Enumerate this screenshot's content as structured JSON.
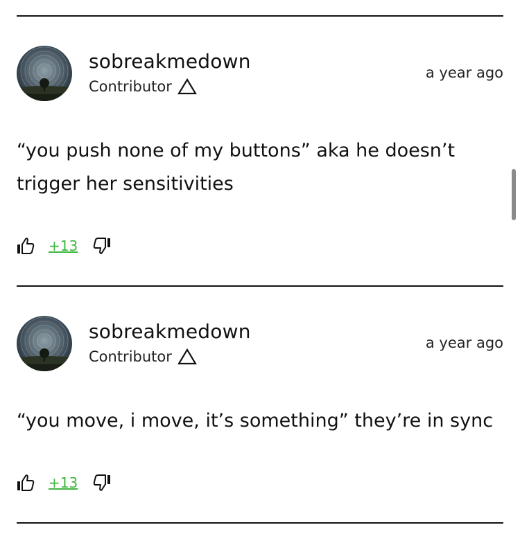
{
  "comments": [
    {
      "username": "sobreakmedown",
      "role": "Contributor",
      "timestamp": "a year ago",
      "text": "“you push none of my buttons” aka he doesn’t trigger her sensitivities",
      "score": "+13",
      "icons": {
        "role": "triangle-icon",
        "upvote": "thumbs-up-icon",
        "downvote": "thumbs-down-icon"
      }
    },
    {
      "username": "sobreakmedown",
      "role": "Contributor",
      "timestamp": "a year ago",
      "text": "“you move, i move, it’s something” they’re in sync",
      "score": "+13",
      "icons": {
        "role": "triangle-icon",
        "upvote": "thumbs-up-icon",
        "downvote": "thumbs-down-icon"
      }
    }
  ],
  "colors": {
    "score": "#3fb53f",
    "divider": "#111111",
    "text": "#111111"
  }
}
